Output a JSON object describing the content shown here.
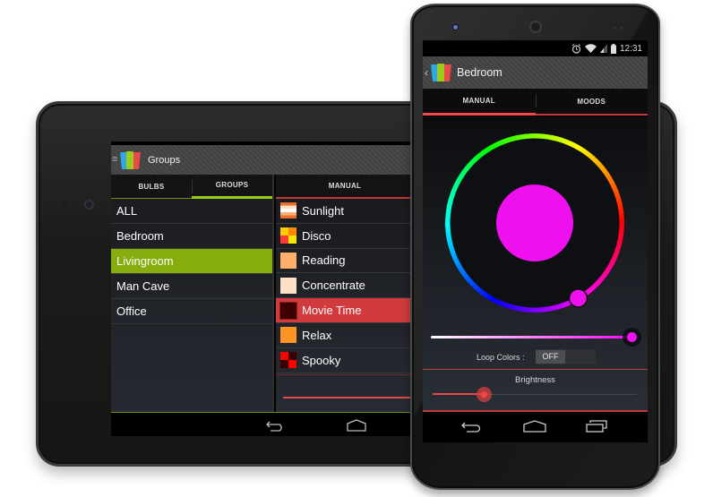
{
  "tablet": {
    "app_title": "Groups",
    "left_tabs": [
      {
        "label": "BULBS",
        "active": false
      },
      {
        "label": "GROUPS",
        "active": true
      }
    ],
    "right_tabs": [
      {
        "label": "MANUAL",
        "active": true
      }
    ],
    "groups": [
      {
        "label": "ALL",
        "selected": false
      },
      {
        "label": "Bedroom",
        "selected": false
      },
      {
        "label": "Livingroom",
        "selected": true
      },
      {
        "label": "Man Cave",
        "selected": false
      },
      {
        "label": "Office",
        "selected": false
      }
    ],
    "moods": [
      {
        "label": "Sunlight",
        "selected": false,
        "icon": "sunlight-swatch-icon",
        "colors": [
          "#e8702a",
          "#fce0c8",
          "#ffffff",
          "#f7b07a"
        ]
      },
      {
        "label": "Disco",
        "selected": false,
        "icon": "disco-swatch-icon",
        "colors": [
          "#ff8a00",
          "#f7e600",
          "#ff3a3a",
          "#ffcc00"
        ]
      },
      {
        "label": "Reading",
        "selected": false,
        "icon": "reading-swatch-icon",
        "colors": [
          "#fcb06a"
        ]
      },
      {
        "label": "Concentrate",
        "selected": false,
        "icon": "concentrate-swatch-icon",
        "colors": [
          "#fde1c6"
        ]
      },
      {
        "label": "Movie Time",
        "selected": true,
        "icon": "movie-time-swatch-icon",
        "colors": [
          "#3d0000"
        ]
      },
      {
        "label": "Relax",
        "selected": false,
        "icon": "relax-swatch-icon",
        "colors": [
          "#ff9426"
        ]
      },
      {
        "label": "Spooky",
        "selected": false,
        "icon": "spooky-swatch-icon",
        "colors": [
          "#ff0000",
          "#3a0000"
        ]
      }
    ],
    "accent_green": "#86ad0d",
    "accent_red": "#d13b3e"
  },
  "phone": {
    "status": {
      "time": "12:31",
      "icons": [
        "alarm-icon",
        "wifi-icon",
        "signal-icon",
        "battery-icon"
      ]
    },
    "app_title": "Bedroom",
    "tabs": [
      {
        "label": "MANUAL",
        "active": true
      },
      {
        "label": "MOODS",
        "active": false
      }
    ],
    "color_wheel": {
      "selected_color": "#ee10ee",
      "hue_degrees": 300
    },
    "saturation_slider": {
      "value_percent": 100
    },
    "loop_colors": {
      "label": "Loop Colors :",
      "state": "OFF"
    },
    "brightness": {
      "label": "Brightness",
      "value_percent": 25
    },
    "accent_red": "#e84848"
  },
  "nav_icons": [
    "back-icon",
    "home-icon",
    "recent-apps-icon"
  ]
}
